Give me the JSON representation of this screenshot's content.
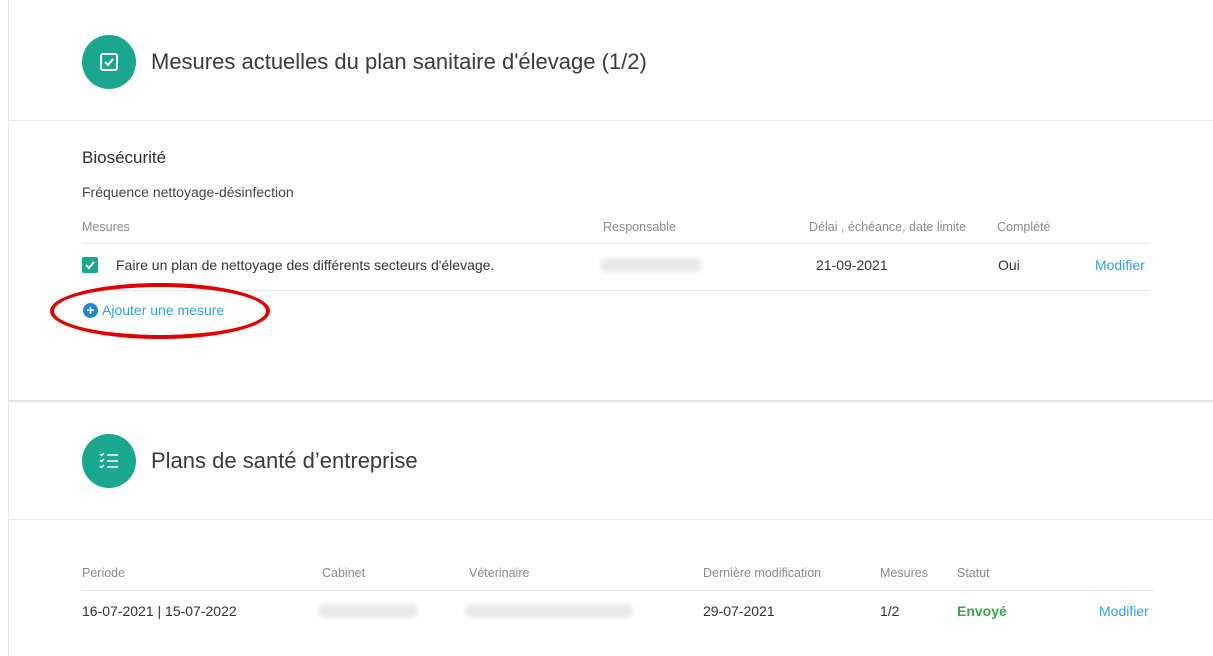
{
  "section1": {
    "title": "Mesures actuelles du plan sanitaire d'élevage (1/2)",
    "icon": "checkbox-icon",
    "category": "Biosécurité",
    "subcategory": "Fréquence nettoyage-désinfection",
    "columns": [
      "Mesures",
      "Responsable",
      "Délai , échéance, date limite",
      "Complété"
    ],
    "rows": [
      {
        "mesure": "Faire un plan de nettoyage des différents secteurs d'élevage.",
        "responsable": "",
        "delai": "21-09-2021",
        "complete": "Oui",
        "action": "Modifier"
      }
    ],
    "add_label": "Ajouter une mesure"
  },
  "section2": {
    "title": "Plans de santé d’entreprise",
    "icon": "checklist-icon",
    "columns": [
      "Periode",
      "Cabinet",
      "Véterinaire",
      "Dernière modification",
      "Mesures",
      "Statut"
    ],
    "rows": [
      {
        "periode": "16-07-2021 | 15-07-2022",
        "cabinet": "",
        "veterinaire": "",
        "derniere_modification": "29-07-2021",
        "mesures": "1/2",
        "statut": "Envoyé",
        "action": "Modifier"
      }
    ]
  },
  "colors": {
    "accent": "#1aa68f",
    "link": "#2fa3d8",
    "status_sent": "#3aa34a",
    "highlight": "#e10000"
  }
}
